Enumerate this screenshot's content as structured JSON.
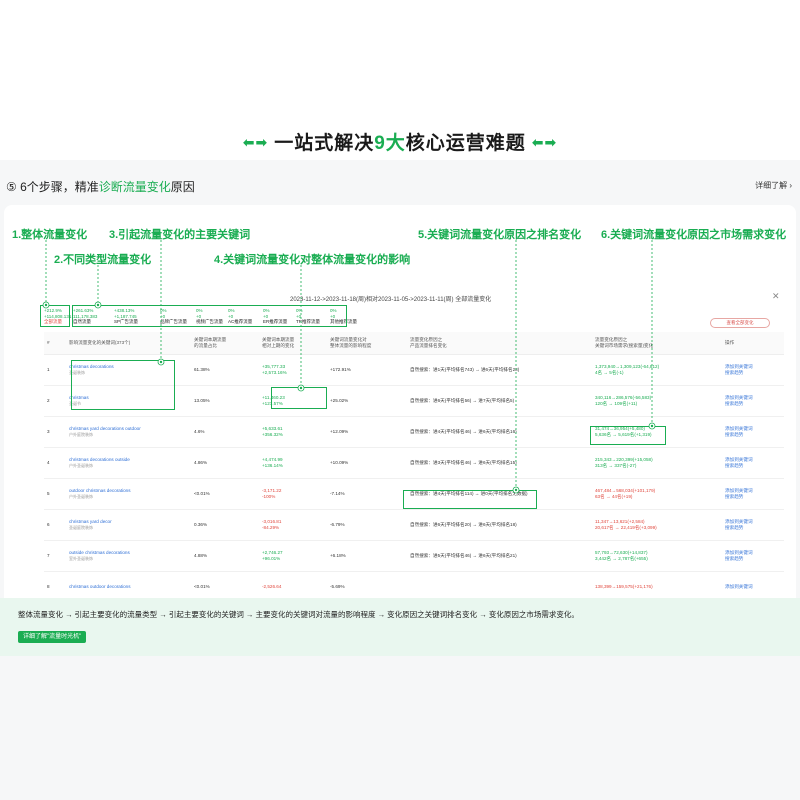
{
  "hero": {
    "prefix": "一站式解决",
    "highlight": "9大",
    "suffix": "核心运营难题",
    "left_arrows": "⬅➡",
    "right_arrows": "⬅➡"
  },
  "step": {
    "prefix": "⑤ 6个步骤，精准",
    "highlight": "诊断流量变化",
    "suffix": "原因",
    "detail_link": "详细了解 ›"
  },
  "annotations": {
    "a1": "1.整体流量变化",
    "a2": "2.不同类型流量变化",
    "a3": "3.引起流量变化的主要关键词",
    "a4": "4.关键词流量变化对整体流量变化的影响",
    "a5": "5.关键词流量变化原因之排名变化",
    "a6": "6.关键词流量变化原因之市场需求变化"
  },
  "date_header": "2023-11-12->2023-11-18(周)相对2023-11-05->2023-11-11(周) 全部流量变化",
  "total": {
    "pct": "+212.9%",
    "val": "+114,808.131",
    "label": "全部流量"
  },
  "metrics": [
    {
      "pct": "+261.63%",
      "val": "111,178.383",
      "label": "自然流量"
    },
    {
      "pct": "+438.13%",
      "val": "+1,187.745",
      "label": "SP广告流量"
    },
    {
      "pct": "0%",
      "val": "+0",
      "label": "品牌广告流量"
    },
    {
      "pct": "0%",
      "val": "+0",
      "label": "视频广告流量"
    },
    {
      "pct": "0%",
      "val": "+0",
      "label": "AC推荐流量"
    },
    {
      "pct": "0%",
      "val": "+0",
      "label": "ER推荐流量"
    },
    {
      "pct": "0%",
      "val": "+0",
      "label": "TR推荐流量"
    },
    {
      "pct": "0%",
      "val": "+0",
      "label": "其他推荐流量"
    }
  ],
  "filter_button": "查看全部变化",
  "table": {
    "headers": [
      "#",
      "影响流量变化的关键词(373个)",
      "关键词本期流量\n的流量占比",
      "关键词本期流量\n相对上期的变化",
      "关键词流量变化对\n整体流量的影响程度",
      "流量变化原因之\n产品流量排名变化",
      "流量变化原因之\n关键词市场需求(搜索量)变化",
      "操作"
    ],
    "rows": [
      {
        "n": "1",
        "kw": "christmas decorations",
        "sub": "圣诞装饰",
        "share": "61.38%",
        "chg": "+35,777.33",
        "chgp": "+2,573.16%",
        "impact": "+172.91%",
        "rank": "自然搜索：进1天(平均排名743) → 进6天(平均排名28)",
        "dem": "1,373,940→1,309,123(-64,812)",
        "dem2": "4名 → 5名(-1)",
        "sign": "pos",
        "op1": "添加到关键词",
        "op2": "搜索趋势"
      },
      {
        "n": "2",
        "kw": "christmas",
        "sub": "圣诞节",
        "share": "13.05%",
        "chg": "+11,460.23",
        "chgp": "+127.57%",
        "impact": "+25.02%",
        "rank": "自然搜索：进6天(平均排名56) → 进7天(平均排名5)",
        "dem": "340,116→286,576(-56,583)",
        "dem2": "120名 → 109名(+11)",
        "sign": "pos",
        "op1": "添加到关键词",
        "op2": "搜索趋势"
      },
      {
        "n": "3",
        "kw": "christmas yard decorations outdoor",
        "sub": "户外庭院装饰",
        "share": "4.6%",
        "chg": "+5,633.61",
        "chgp": "+356.32%",
        "impact": "+12.09%",
        "rank": "自然搜索：进4天(平均排名46) → 进6天(平均排名16)",
        "dem": "31,474→36,954(+5,480)",
        "dem2": "5,636名 → 5,619名(+1,319)",
        "sign": "pos",
        "op1": "添加到关键词",
        "op2": "搜索趋势"
      },
      {
        "n": "4",
        "kw": "christmas decorations outside",
        "sub": "户外圣诞装饰",
        "share": "4.86%",
        "chg": "+4,474.99",
        "chgp": "+136.14%",
        "impact": "+10.09%",
        "rank": "自然搜索：进3天(平均排名46) → 进6天(平均排名15)",
        "dem": "215,343→220,399(+15,058)",
        "dem2": "313名 → 337名(-27)",
        "sign": "pos",
        "op1": "添加到关键词",
        "op2": "搜索趋势"
      },
      {
        "n": "5",
        "kw": "outdoor christmas decorations",
        "sub": "户外圣诞装饰",
        "share": "<0.01%",
        "chg": "-3,171.22",
        "chgp": "-100%",
        "impact": "-7.14%",
        "rank": "自然搜索：进4天(平均排名114) → 进0天(平均排名无数据)",
        "dem": "467,484→568,034(+101,179)",
        "dem2": "63名 → 44名(+19)",
        "sign": "neg",
        "op1": "添加到关键词",
        "op2": "搜索趋势"
      },
      {
        "n": "6",
        "kw": "christmas yard decor",
        "sub": "圣诞庭院装饰",
        "share": "0.36%",
        "chg": "-3,016.81",
        "chgp": "-84.29%",
        "impact": "-6.79%",
        "rank": "自然搜索：进6天(平均排名20) → 进6天(平均排名18)",
        "dem": "11,347→13,621(+2,584)",
        "dem2": "20,617名 → 22,419名(+3,099)",
        "sign": "neg",
        "op1": "添加到关键词",
        "op2": "搜索趋势"
      },
      {
        "n": "7",
        "kw": "outside christmas decorations",
        "sub": "室外圣诞装饰",
        "share": "4.88%",
        "chg": "+2,746.27",
        "chgp": "+96.01%",
        "impact": "+6.18%",
        "rank": "自然搜索：进5天(平均排名46) → 进6天(平均排名21)",
        "dem": "57,793→72,630(+14,837)",
        "dem2": "3,442名 → 2,787名(+655)",
        "sign": "pos",
        "op1": "添加到关键词",
        "op2": "搜索趋势"
      },
      {
        "n": "8",
        "kw": "christmas outdoor decorations",
        "sub": "",
        "share": "<0.01%",
        "chg": "-2,526.64",
        "chgp": "",
        "impact": "-5.69%",
        "rank": "",
        "dem": "138,399→159,575(+21,176)",
        "dem2": "",
        "sign": "neg",
        "op1": "添加到关键词",
        "op2": ""
      }
    ]
  },
  "summary": "整体流量变化 → 引起主要变化的流量类型 → 引起主要变化的关键词 → 主要变化的关键词对流量的影响程度 → 变化原因之关键词排名变化 → 变化原因之市场需求变化。",
  "cta_label": "详细了解\"流量时光机\"",
  "colors": {
    "accent": "#1aad52",
    "negative": "#e0463c",
    "link": "#2e6fd6"
  }
}
